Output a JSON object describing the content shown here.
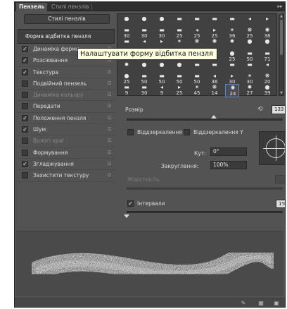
{
  "window": {
    "tabs": [
      {
        "label": "Пензель",
        "active": true
      },
      {
        "label": "Стилі пензлів",
        "active": false
      }
    ],
    "menu_icon": "panel-menu-icon"
  },
  "presets_button": "Стилі пензлів",
  "brush_options": [
    {
      "label": "Форма відбитка пензля",
      "selected": true,
      "has_checkbox": false,
      "checked": false,
      "dim": false
    },
    {
      "label": "Динаміка форми",
      "checked": true,
      "dim": false
    },
    {
      "label": "Розсіювання",
      "checked": true,
      "dim": false
    },
    {
      "label": "Текстура",
      "checked": true,
      "dim": false
    },
    {
      "label": "Подвійний пензель",
      "checked": false,
      "dim": false
    },
    {
      "label": "Динаміка кольору",
      "checked": false,
      "dim": true
    },
    {
      "label": "Передати",
      "checked": false,
      "dim": false
    },
    {
      "label": "Положення пензля",
      "checked": true,
      "dim": false
    },
    {
      "label": "Шум",
      "checked": true,
      "dim": false
    },
    {
      "label": "Вологі краї",
      "checked": false,
      "dim": true
    },
    {
      "label": "Формування",
      "checked": false,
      "dim": false
    },
    {
      "label": "Згладжування",
      "checked": true,
      "dim": false
    },
    {
      "label": "Захистити текстуру",
      "checked": false,
      "dim": false
    }
  ],
  "presets_rows": [
    [
      "",
      "",
      "",
      "",
      "",
      "",
      "",
      "",
      ""
    ],
    [
      "30",
      "30",
      "30",
      "25",
      "25",
      "25",
      "36",
      "25",
      "36"
    ],
    [
      "",
      "",
      "",
      "",
      "",
      "",
      "",
      "",
      ""
    ],
    [
      "",
      "",
      "",
      "",
      "",
      "",
      "25",
      "50",
      "71"
    ],
    [
      "",
      "",
      "",
      "",
      "",
      "",
      "",
      "",
      ""
    ],
    [
      "25",
      "50",
      "50",
      "50",
      "50",
      "36",
      "30",
      "30",
      "20"
    ],
    [
      "9",
      "30",
      "9",
      "25",
      "45",
      "14",
      "24",
      "27",
      "39"
    ]
  ],
  "selected_preset": "24",
  "tooltip": "Налаштувати форму відбитка пензля",
  "size": {
    "label": "Розмір",
    "value": "133 пікс"
  },
  "flip_x": {
    "label": "Віддзеркалення X",
    "checked": false
  },
  "flip_y": {
    "label": "Віддзеркалення Y",
    "checked": false
  },
  "angle": {
    "label": "Кут:",
    "value": "0°"
  },
  "roundness": {
    "label": "Закруглення:",
    "value": "100%"
  },
  "hardness": {
    "label": "Жорсткість"
  },
  "spacing": {
    "label": "Інтервали",
    "checked": true,
    "value": "1%"
  },
  "preview": {
    "stroke": "brush-stroke-preview"
  },
  "statusbar": {
    "icons": [
      "stylus-icon",
      "grid-icon",
      "new-preset-icon"
    ]
  }
}
